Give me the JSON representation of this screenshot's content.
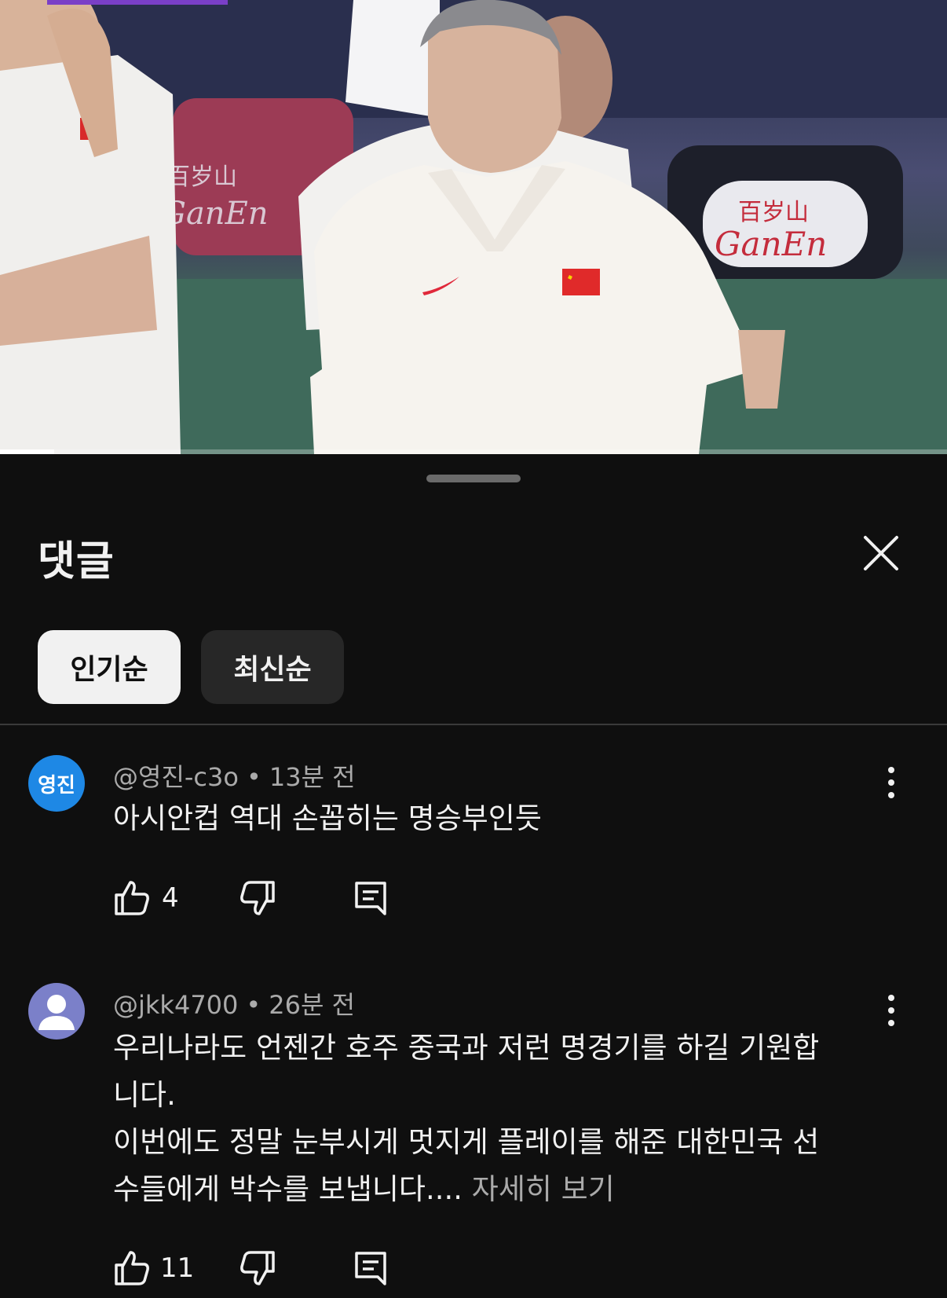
{
  "video": {
    "progress_fraction": 0.057
  },
  "sheet": {
    "title": "댓글",
    "sort_chips": [
      {
        "label": "인기순",
        "selected": true
      },
      {
        "label": "최신순",
        "selected": false
      }
    ]
  },
  "comments": [
    {
      "avatar_text": "영진",
      "avatar_color": "#1e88e5",
      "author": "@영진-c3o",
      "time": "13분 전",
      "text_lines": [
        "아시안컵 역대 손꼽히는 명승부인듯"
      ],
      "more_label": "",
      "likes": "4"
    },
    {
      "avatar_text": "",
      "avatar_color": "#7b80c9",
      "author": "@jkk4700",
      "time": "26분 전",
      "text_lines": [
        "우리나라도 언젠간 호주 중국과 저런 명경기를 하길 기원합",
        "니다.",
        "이번에도 정말 눈부시게 멋지게 플레이를 해준 대한민국 선",
        "수들에게 박수를 보냅니다...."
      ],
      "more_label": "자세히 보기",
      "likes": "11"
    }
  ],
  "icons": {
    "close": "close-icon",
    "more": "more-vert-icon",
    "like": "thumbs-up-icon",
    "dislike": "thumbs-down-icon",
    "reply": "reply-icon",
    "default_avatar": "person-icon"
  },
  "colors": {
    "background": "#0f0f0f",
    "chip_active": "#f1f1f1",
    "chip_inactive": "#272727",
    "secondary_text": "#aaaaaa"
  }
}
